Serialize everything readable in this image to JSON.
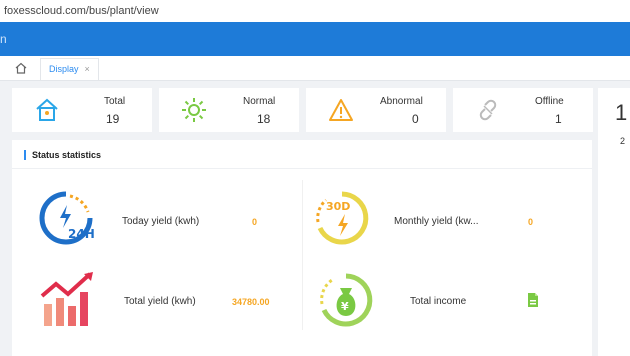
{
  "browser": {
    "url": "foxesscloud.com/bus/plant/view"
  },
  "topbar": {
    "edge_glyph": "n"
  },
  "tabs": [
    {
      "label": "Display",
      "close": "×"
    }
  ],
  "status_cards": [
    {
      "label": "Total",
      "value": "19",
      "icon": "house-icon",
      "color": "#2aa6e8"
    },
    {
      "label": "Normal",
      "value": "18",
      "icon": "sun-icon",
      "color": "#7ac943"
    },
    {
      "label": "Abnormal",
      "value": "0",
      "icon": "warning-icon",
      "color": "#f5a623"
    },
    {
      "label": "Offline",
      "value": "1",
      "icon": "broken-link-icon",
      "color": "#bbbbbb"
    }
  ],
  "right_panel": {
    "big_number": "1",
    "small_number": "2"
  },
  "status_statistics": {
    "title": "Status statistics",
    "metrics": [
      {
        "label": "Today yield (kwh)",
        "value": "0",
        "icon": "24h-icon"
      },
      {
        "label": "Monthly yield (kw...",
        "value": "0",
        "icon": "30d-icon"
      },
      {
        "label": "Total yield (kwh)",
        "value": "34780.00",
        "icon": "bar-chart-trend-icon"
      },
      {
        "label": "Total income",
        "value": "",
        "icon": "money-bag-icon"
      }
    ]
  },
  "colors": {
    "brand_blue": "#1e7bd8",
    "accent_orange": "#f5a623",
    "accent_green": "#7ac943"
  }
}
